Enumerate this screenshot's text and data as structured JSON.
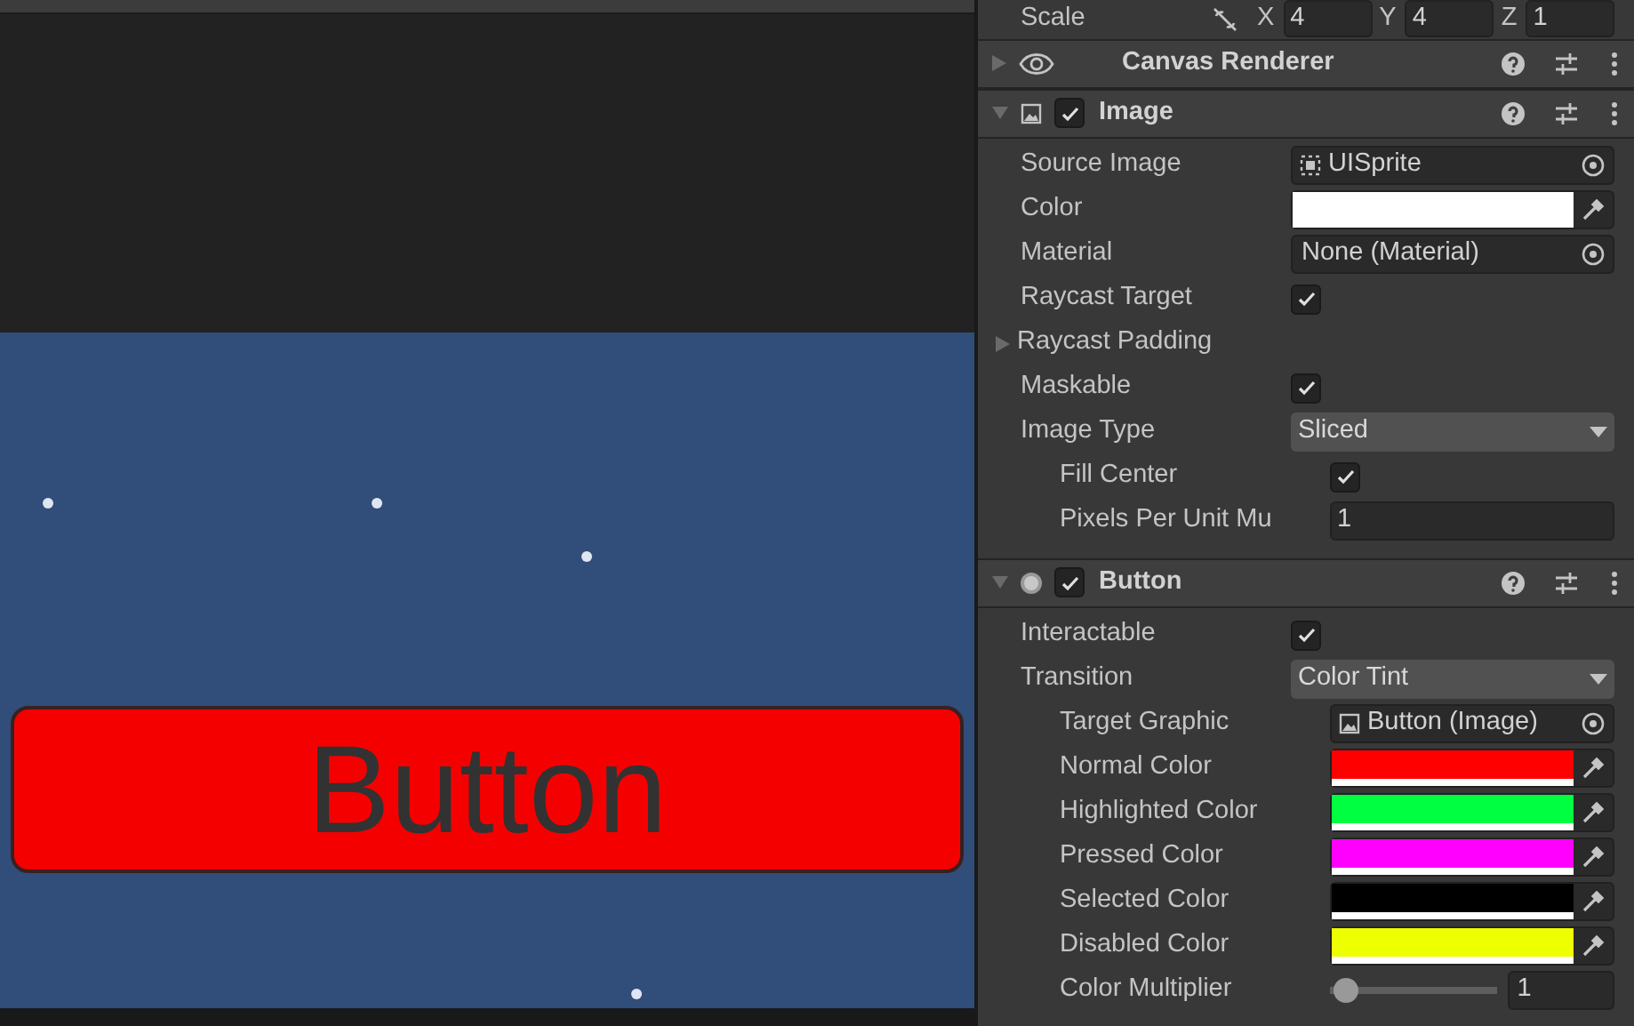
{
  "game_view": {
    "button_label": "Button"
  },
  "inspector": {
    "scale": {
      "label": "Scale",
      "axes": [
        {
          "axis": "X",
          "value": "4"
        },
        {
          "axis": "Y",
          "value": "4"
        },
        {
          "axis": "Z",
          "value": "1"
        }
      ]
    },
    "components": [
      {
        "title": "Canvas Renderer",
        "expanded": false
      },
      {
        "title": "Image",
        "expanded": true,
        "enabled": true,
        "rows": [
          {
            "kind": "sprite",
            "label": "Source Image",
            "value": "UISprite"
          },
          {
            "kind": "color",
            "label": "Color",
            "color": "#ffffff"
          },
          {
            "kind": "object",
            "label": "Material",
            "value": "None (Material)"
          },
          {
            "kind": "checkbox",
            "label": "Raycast Target",
            "checked": true
          },
          {
            "kind": "foldout",
            "label": "Raycast Padding",
            "expanded": false
          },
          {
            "kind": "checkbox",
            "label": "Maskable",
            "checked": true
          },
          {
            "kind": "dropdown",
            "label": "Image Type",
            "value": "Sliced",
            "children": [
              {
                "kind": "checkbox",
                "label": "Fill Center",
                "checked": true
              },
              {
                "kind": "number",
                "label": "Pixels Per Unit Mu",
                "value": "1"
              }
            ]
          }
        ]
      },
      {
        "title": "Button",
        "expanded": true,
        "enabled": true,
        "rows": [
          {
            "kind": "checkbox",
            "label": "Interactable",
            "checked": true
          },
          {
            "kind": "dropdown",
            "label": "Transition",
            "value": "Color Tint",
            "children": [
              {
                "kind": "graphic",
                "label": "Target Graphic",
                "value": "Button (Image)"
              },
              {
                "kind": "color",
                "label": "Normal Color",
                "color": "#ff0000"
              },
              {
                "kind": "color",
                "label": "Highlighted Color",
                "color": "#00ff40"
              },
              {
                "kind": "color",
                "label": "Pressed Color",
                "color": "#ff00ff"
              },
              {
                "kind": "color",
                "label": "Selected Color",
                "color": "#000000"
              },
              {
                "kind": "color",
                "label": "Disabled Color",
                "color": "#eeff00"
              },
              {
                "kind": "slider",
                "label": "Color Multiplier",
                "level": 0.02,
                "value": "1"
              }
            ]
          }
        ]
      }
    ]
  }
}
